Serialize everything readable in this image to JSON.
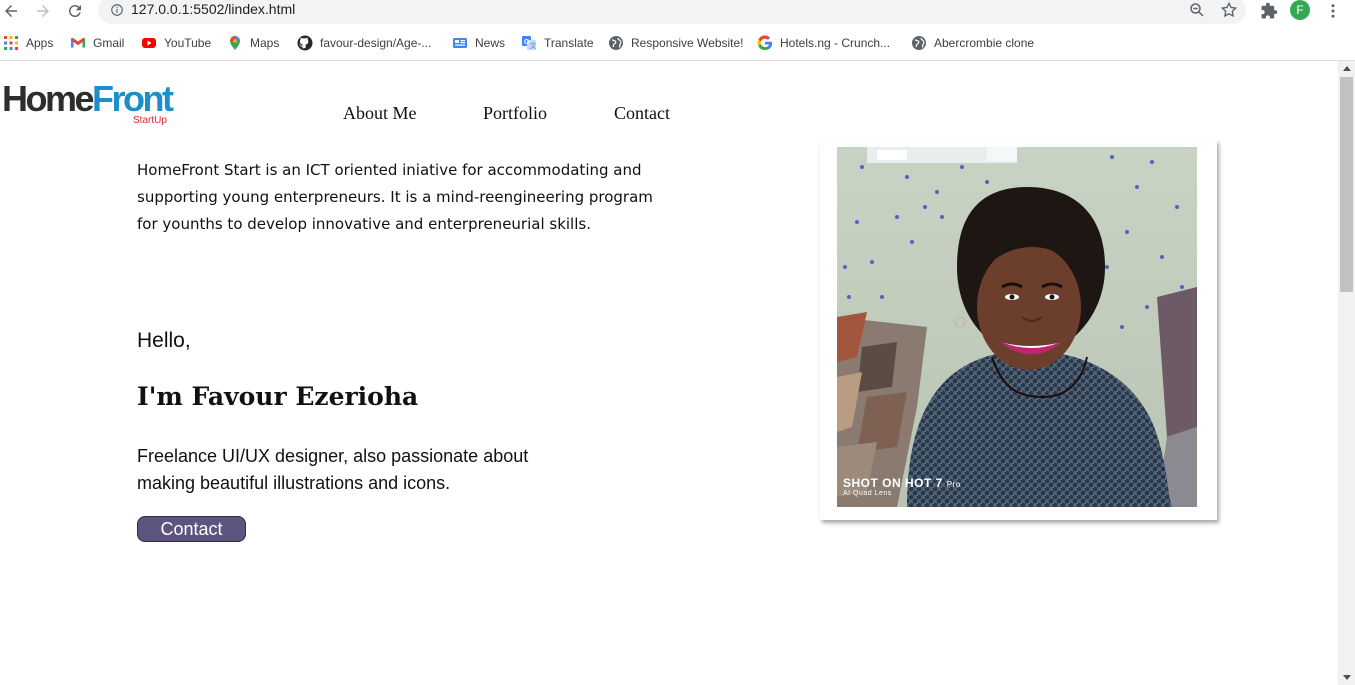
{
  "browser": {
    "url": "127.0.0.1:5502/lindex.html",
    "profile_initial": "F",
    "profile_color": "#34a853",
    "bookmarks": [
      {
        "label": "Apps",
        "icon": "apps-grid-icon"
      },
      {
        "label": "Gmail",
        "icon": "gmail-icon"
      },
      {
        "label": "YouTube",
        "icon": "youtube-icon"
      },
      {
        "label": "Maps",
        "icon": "maps-pin-icon"
      },
      {
        "label": "favour-design/Age-...",
        "icon": "github-icon"
      },
      {
        "label": "News",
        "icon": "news-icon"
      },
      {
        "label": "Translate",
        "icon": "translate-icon"
      },
      {
        "label": "Responsive Website!",
        "icon": "globe-icon"
      },
      {
        "label": "Hotels.ng - Crunch...",
        "icon": "google-icon"
      },
      {
        "label": "Abercrombie clone",
        "icon": "globe-icon"
      }
    ]
  },
  "site": {
    "logo": {
      "home": "Home",
      "front": "Front",
      "sub": "StartUp"
    },
    "nav": [
      "About Me",
      "Portfolio",
      "Contact"
    ],
    "intro": "HomeFront Start is an ICT oriented iniative for accommodating and supporting young enterpreneurs. It is a mind-reengineering program for younths to develop innovative and enterpreneurial skills.",
    "hello": "Hello,",
    "name": "I'm Favour Ezerioha",
    "tagline": "Freelance UI/UX designer, also passionate about making beautiful illustrations and icons.",
    "cta_label": "Contact",
    "cta_color": "#5d5580",
    "photo_watermark": {
      "line1": "SHOT ON HOT 7",
      "line1_suffix": "Pro",
      "line2": "AI Quad Lens"
    }
  }
}
